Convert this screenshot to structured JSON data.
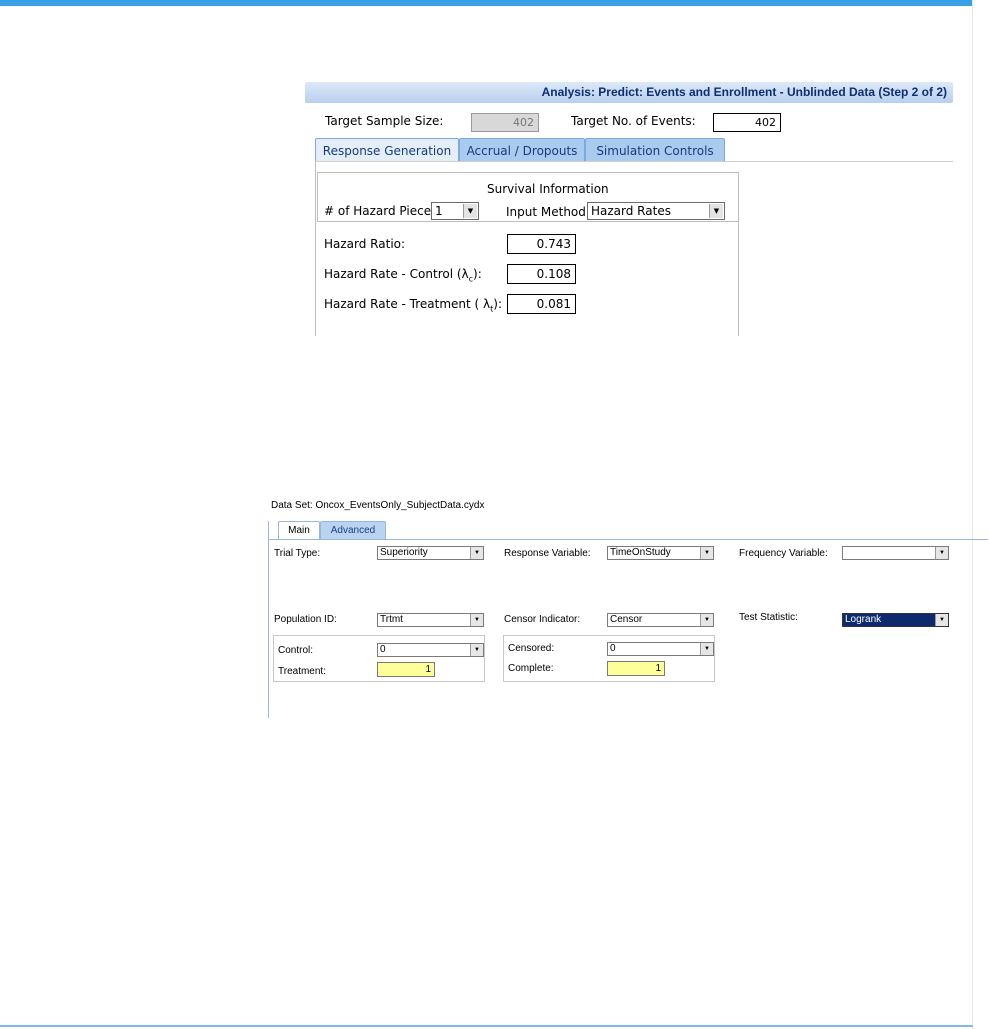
{
  "panel1": {
    "header": "Analysis: Predict: Events and Enrollment - Unblinded Data (Step 2 of 2)",
    "target_sample_size_label": "Target Sample Size:",
    "target_sample_size_value": "402",
    "target_events_label": "Target No. of Events:",
    "target_events_value": "402",
    "tabs": [
      "Response Generation",
      "Accrual / Dropouts",
      "Simulation Controls"
    ],
    "survival_title": "Survival Information",
    "hazard_pieces_label": "# of Hazard Pieces:",
    "hazard_pieces_value": "1",
    "input_method_label": "Input Method:",
    "input_method_value": "Hazard Rates",
    "hazard_ratio_label": "Hazard Ratio:",
    "hazard_ratio_value": "0.743",
    "hazard_control_label": "Hazard Rate - Control (λ",
    "hazard_control_sub": "c",
    "hazard_control_tail": "):",
    "hazard_control_value": "0.108",
    "hazard_treatment_label": "Hazard Rate - Treatment ( λ",
    "hazard_treatment_sub": "t",
    "hazard_treatment_tail": "):",
    "hazard_treatment_value": "0.081"
  },
  "panel2": {
    "dataset_label": "Data Set: Oncox_EventsOnly_SubjectData.cydx",
    "tabs": [
      "Main",
      "Advanced"
    ],
    "trial_type_label": "Trial Type:",
    "trial_type_value": "Superiority",
    "response_variable_label": "Response Variable:",
    "response_variable_value": "TimeOnStudy",
    "frequency_variable_label": "Frequency Variable:",
    "frequency_variable_value": "",
    "population_id_label": "Population ID:",
    "population_id_value": "Trtmt",
    "censor_indicator_label": "Censor Indicator:",
    "censor_indicator_value": "Censor",
    "test_statistic_label": "Test Statistic:",
    "test_statistic_value": "Logrank",
    "control_label": "Control:",
    "control_value": "0",
    "treatment_label": "Treatment:",
    "treatment_value": "1",
    "censored_label": "Censored:",
    "censored_value": "0",
    "complete_label": "Complete:",
    "complete_value": "1"
  }
}
